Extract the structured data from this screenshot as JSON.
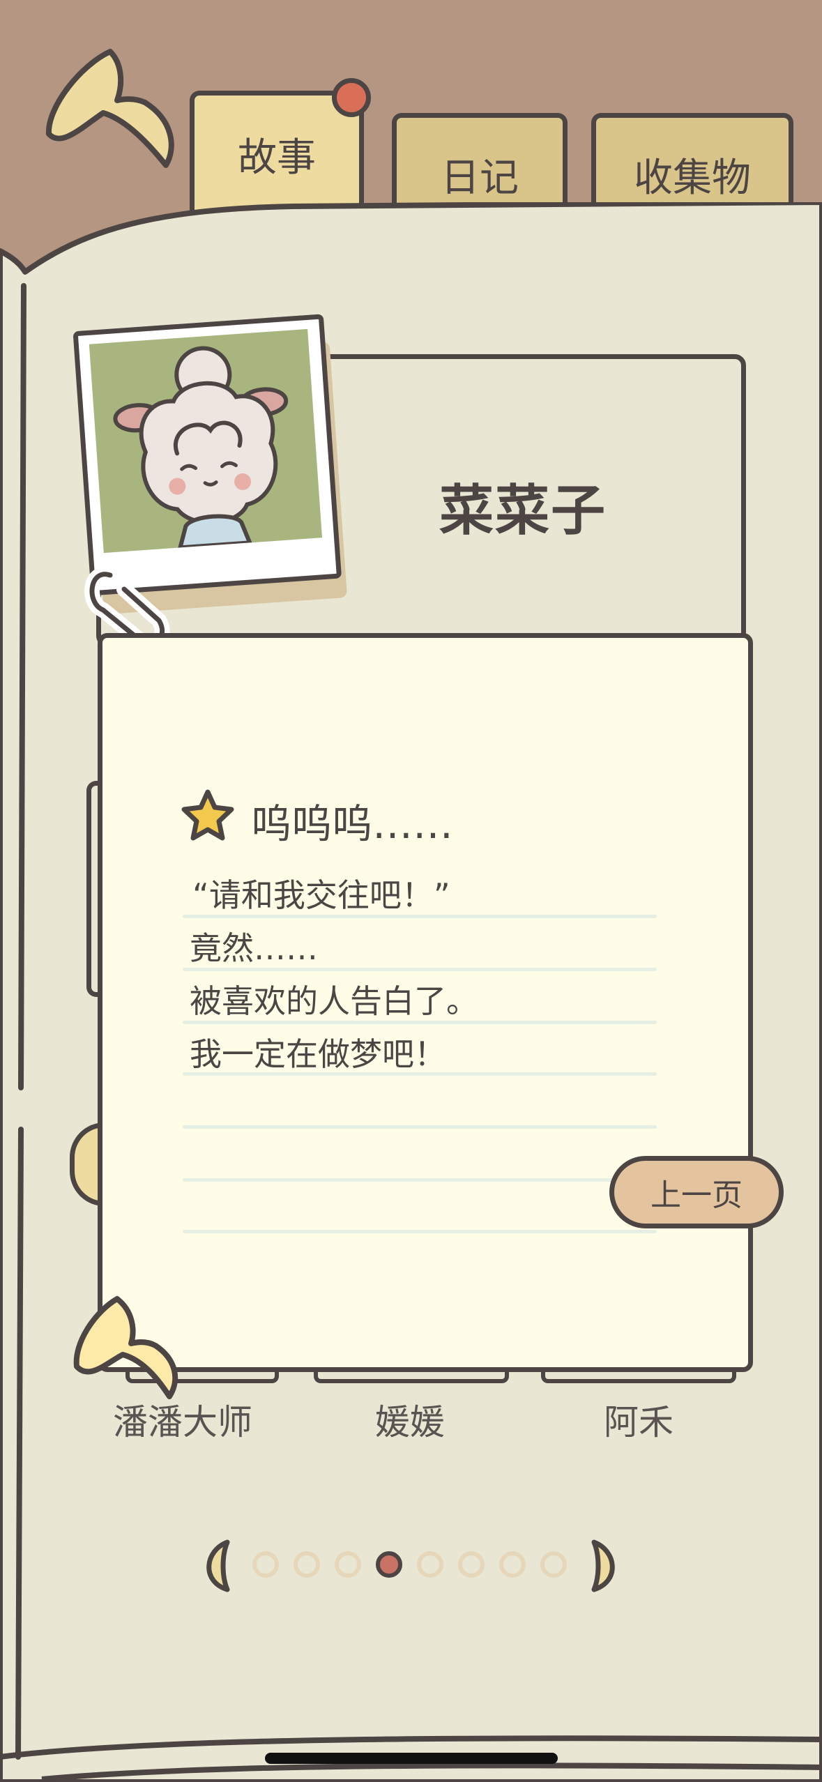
{
  "tabs": [
    {
      "label": "故事",
      "active": true
    },
    {
      "label": "日记",
      "active": false
    },
    {
      "label": "收集物",
      "active": false
    }
  ],
  "character": {
    "name": "菜菜子"
  },
  "story": {
    "title": "呜呜呜……",
    "lines": [
      "“请和我交往吧！”",
      "竟然……",
      "被喜欢的人告白了。",
      "我一定在做梦吧！"
    ],
    "prev_label": "上一页"
  },
  "characters_below": [
    "潘潘大师",
    "媛媛",
    "阿禾"
  ],
  "pagination": {
    "total": 8,
    "current": 4
  },
  "colors": {
    "background": "#B59683",
    "book_page": "#E9E6D3",
    "note_paper": "#FFFDE7",
    "outline": "#4C4544",
    "tab_active": "#EEDB9F",
    "accent_dot": "#D96F57",
    "photo_bg": "#A8B57E"
  },
  "icons": {
    "back": "back-arrow-icon",
    "star": "star-icon",
    "paperclip": "paperclip-icon"
  }
}
